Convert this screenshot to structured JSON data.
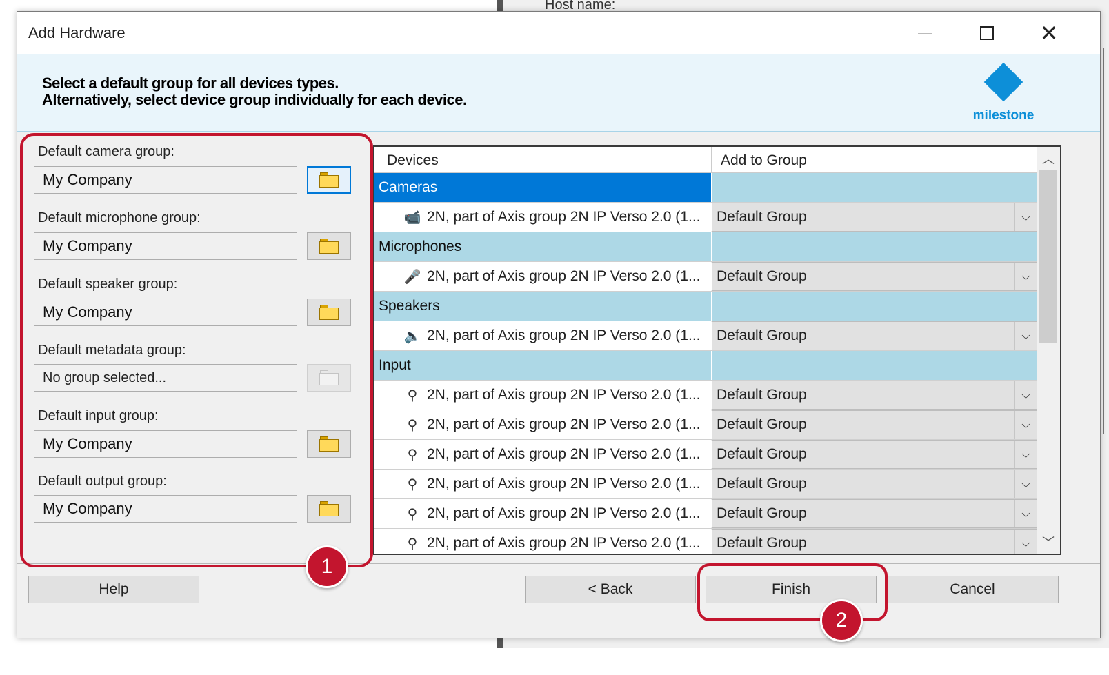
{
  "background": {
    "host_label": "Host name:"
  },
  "window": {
    "title": "Add Hardware"
  },
  "header": {
    "line1": "Select a default group for all devices types.",
    "line2": "Alternatively, select device group individually for each device.",
    "logo_text": "milestone"
  },
  "defaults": [
    {
      "label": "Default camera group:",
      "value": "My Company",
      "enabled": true
    },
    {
      "label": "Default microphone group:",
      "value": "My Company",
      "enabled": true
    },
    {
      "label": "Default speaker group:",
      "value": "My Company",
      "enabled": true
    },
    {
      "label": "Default metadata group:",
      "value": "No group selected...",
      "enabled": false
    },
    {
      "label": "Default input group:",
      "value": "My Company",
      "enabled": true
    },
    {
      "label": "Default output group:",
      "value": "My Company",
      "enabled": true
    }
  ],
  "grid": {
    "columns": [
      "Devices",
      "Add to Group"
    ],
    "rows": [
      {
        "type": "category",
        "label": "Cameras",
        "selected": true
      },
      {
        "type": "device",
        "icon": "camera-icon",
        "name": "2N, part of Axis group 2N IP Verso 2.0 (1...",
        "group": "Default Group"
      },
      {
        "type": "category",
        "label": "Microphones"
      },
      {
        "type": "device",
        "icon": "microphone-icon",
        "name": "2N, part of Axis group 2N IP Verso 2.0 (1...",
        "group": "Default Group"
      },
      {
        "type": "category",
        "label": "Speakers"
      },
      {
        "type": "device",
        "icon": "speaker-icon",
        "name": "2N, part of Axis group 2N IP Verso 2.0 (1...",
        "group": "Default Group"
      },
      {
        "type": "category",
        "label": "Input"
      },
      {
        "type": "device",
        "icon": "input-icon",
        "name": "2N, part of Axis group 2N IP Verso 2.0 (1...",
        "group": "Default Group"
      },
      {
        "type": "device",
        "icon": "input-icon",
        "name": "2N, part of Axis group 2N IP Verso 2.0 (1...",
        "group": "Default Group"
      },
      {
        "type": "device",
        "icon": "input-icon",
        "name": "2N, part of Axis group 2N IP Verso 2.0 (1...",
        "group": "Default Group"
      },
      {
        "type": "device",
        "icon": "input-icon",
        "name": "2N, part of Axis group 2N IP Verso 2.0 (1...",
        "group": "Default Group"
      },
      {
        "type": "device",
        "icon": "input-icon",
        "name": "2N, part of Axis group 2N IP Verso 2.0 (1...",
        "group": "Default Group"
      },
      {
        "type": "device",
        "icon": "input-icon",
        "name": "2N, part of Axis group 2N IP Verso 2.0 (1...",
        "group": "Default Group"
      }
    ]
  },
  "buttons": {
    "help": "Help",
    "back": "< Back",
    "finish": "Finish",
    "cancel": "Cancel"
  },
  "callouts": {
    "one": "1",
    "two": "2"
  },
  "colors": {
    "accent": "#0078d7",
    "category_bg": "#add8e6",
    "callout": "#c3152e",
    "logo": "#0d8fd8"
  }
}
